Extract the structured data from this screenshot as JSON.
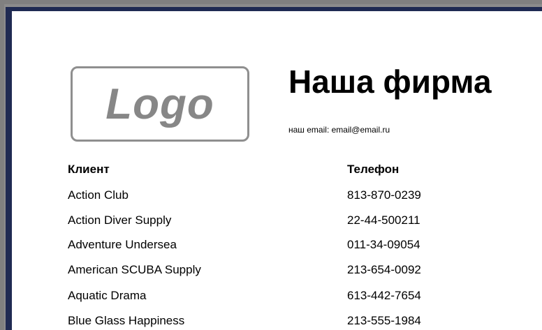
{
  "header": {
    "logo_text": "Logo",
    "company_name": "Наша фирма",
    "email_line": "наш email: email@email.ru"
  },
  "table": {
    "columns": [
      "Клиент",
      "Телефон"
    ],
    "rows": [
      {
        "client": "Action Club",
        "phone": "813-870-0239"
      },
      {
        "client": "Action Diver Supply",
        "phone": "22-44-500211"
      },
      {
        "client": "Adventure Undersea",
        "phone": "011-34-09054"
      },
      {
        "client": "American SCUBA Supply",
        "phone": "213-654-0092"
      },
      {
        "client": "Aquatic Drama",
        "phone": "613-442-7654"
      },
      {
        "client": "Blue Glass Happiness",
        "phone": "213-555-1984"
      }
    ]
  }
}
